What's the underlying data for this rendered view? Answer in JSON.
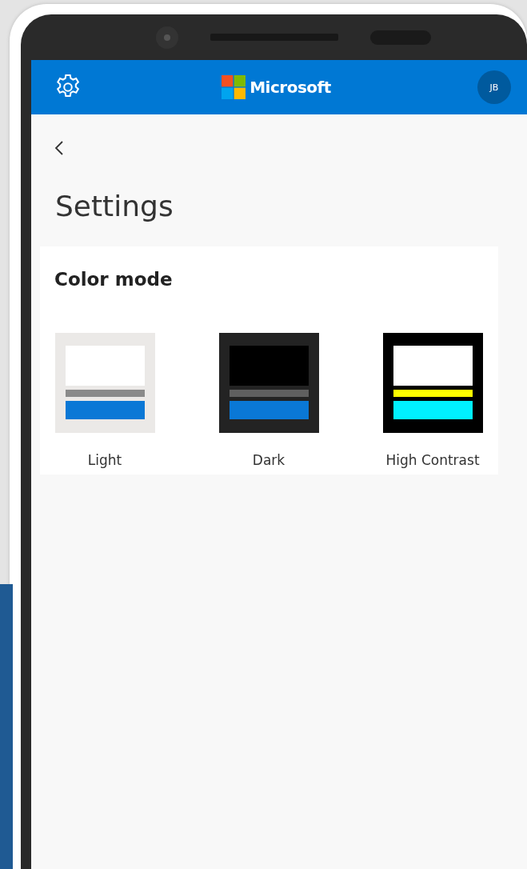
{
  "header": {
    "brand": "Microsoft",
    "avatar_initials": "JB"
  },
  "page": {
    "title": "Settings"
  },
  "color_mode": {
    "heading": "Color mode",
    "options": [
      {
        "kind": "light",
        "label": "Light"
      },
      {
        "kind": "dark",
        "label": "Dark"
      },
      {
        "kind": "high-contrast",
        "label": "High Contrast"
      }
    ]
  }
}
